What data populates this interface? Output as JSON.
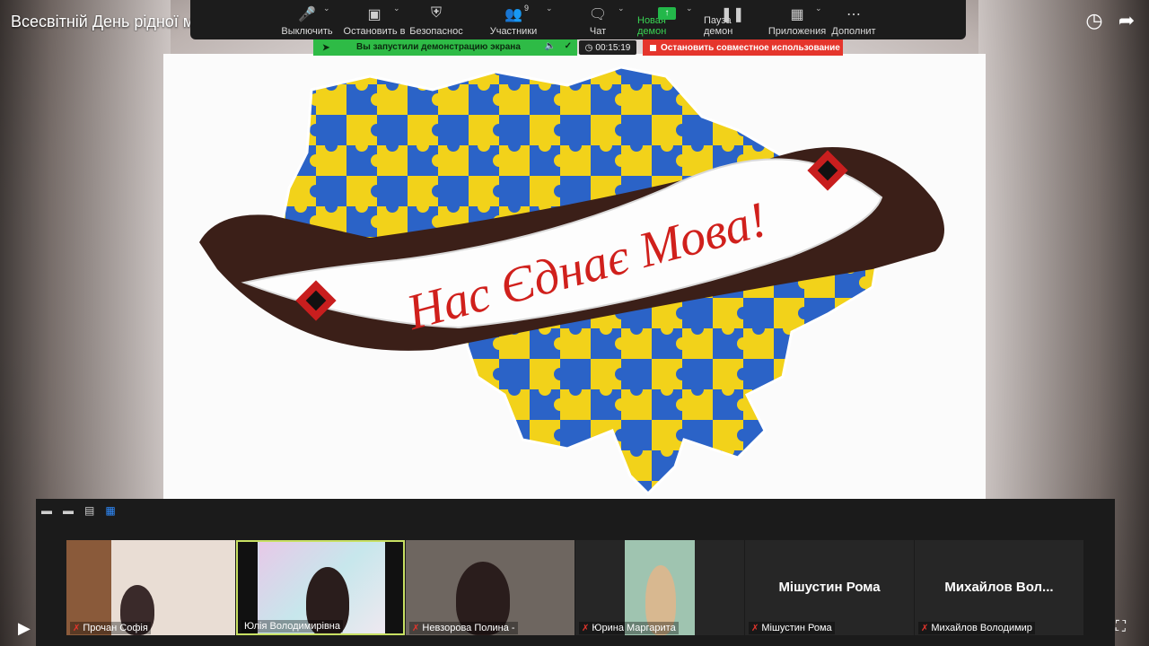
{
  "youtube": {
    "title": "Всесвітній День рідної м",
    "icons": [
      "clock-icon",
      "share-icon"
    ]
  },
  "toolbar": {
    "buttons": [
      {
        "label": "Выключить",
        "icon": "microphone-icon"
      },
      {
        "label": "Остановить в",
        "icon": "camera-icon"
      },
      {
        "label": "Безопаснос",
        "icon": "shield-icon"
      },
      {
        "label": "Участники",
        "icon": "participants-icon",
        "count": "9"
      },
      {
        "label": "Чат",
        "icon": "chat-icon"
      },
      {
        "label": "Новая демон",
        "icon": "share-screen-icon"
      },
      {
        "label": "Пауза демон",
        "icon": "pause-icon"
      },
      {
        "label": "Приложения",
        "icon": "apps-icon"
      },
      {
        "label": "Дополнит",
        "icon": "more-icon"
      }
    ]
  },
  "share_bar": {
    "text": "Вы запустили демонстрацию экрана",
    "timer": "00:15:19",
    "stop": "Остановить совместное использование"
  },
  "slide": {
    "banner_text": "Нас Єднає Мова!"
  },
  "gallery": {
    "participants": [
      {
        "name": "Прочан Софія"
      },
      {
        "name": "Юлія Володимирівна"
      },
      {
        "name": "Невзорова Полина -"
      },
      {
        "name": "Юрина Маргарита"
      },
      {
        "name": "Мішустин Рома",
        "display": "Мішустин Рома"
      },
      {
        "name": "Михайлов Володимир",
        "display": "Михайлов  Вол..."
      }
    ]
  },
  "colors": {
    "toolbar": "#1c1c1c",
    "share_green": "#2ebb46",
    "stop_red": "#e5352c",
    "accent_blue": "#2f8cff"
  }
}
